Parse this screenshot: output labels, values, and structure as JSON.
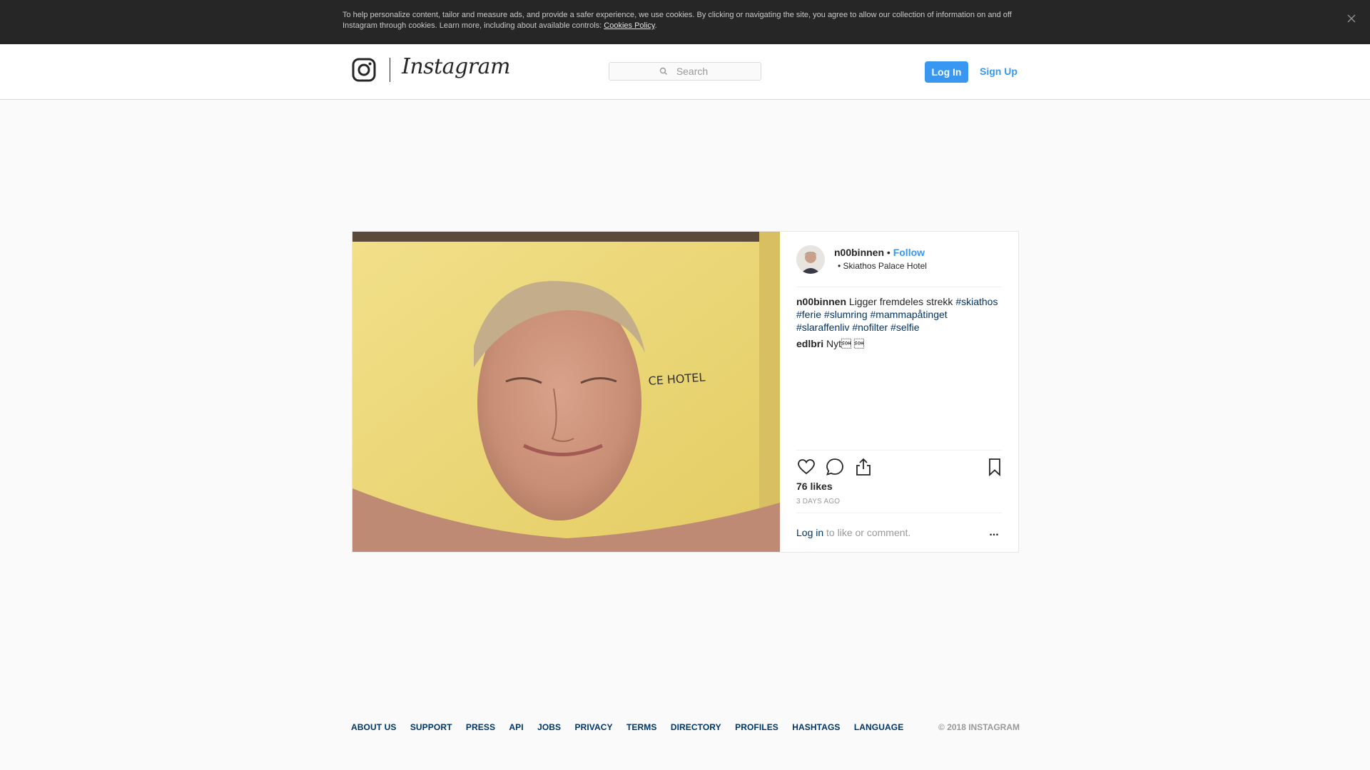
{
  "cookie_banner": {
    "text": "To help personalize content, tailor and measure ads, and provide a safer experience, we use cookies. By clicking or navigating the site, you agree to allow our collection of information on and off Instagram through cookies. Learn more, including about available controls: ",
    "link_label": "Cookies Policy",
    "after_link": ".",
    "close_icon": "close-icon"
  },
  "header": {
    "logo_icon": "instagram-glyph-icon",
    "wordmark": "Instagram",
    "search_placeholder": "Search",
    "login_label": "Log In",
    "signup_label": "Sign Up"
  },
  "post": {
    "owner": "n00binnen",
    "separator": "•",
    "follow_label": "Follow",
    "location": "Skiathos Palace Hotel",
    "location_bullet": "•",
    "caption_user": "n00binnen",
    "caption_text": "Ligger fremdeles strekk",
    "hashtags": [
      "#skiathos",
      "#ferie",
      "#slumring",
      "#mammapåtinget",
      "#slaraffenliv",
      "#nofilter",
      "#selfie"
    ],
    "comments": [
      {
        "user": "edlbri",
        "text": "Nyt\u0001 \u0001"
      }
    ],
    "likes": "76 likes",
    "time": "3 DAYS AGO",
    "login_link": "Log in",
    "login_suffix": " to like or comment.",
    "more_label": "...",
    "action_icons": [
      "heart-icon",
      "comment-icon",
      "share-icon",
      "bookmark-icon"
    ]
  },
  "footer": {
    "links": [
      "ABOUT US",
      "SUPPORT",
      "PRESS",
      "API",
      "JOBS",
      "PRIVACY",
      "TERMS",
      "DIRECTORY",
      "PROFILES",
      "HASHTAGS",
      "LANGUAGE"
    ],
    "copyright": "© 2018 INSTAGRAM"
  },
  "colors": {
    "accent": "#3897f0",
    "link": "#003569",
    "banner": "#262626",
    "background": "#fafafa"
  }
}
